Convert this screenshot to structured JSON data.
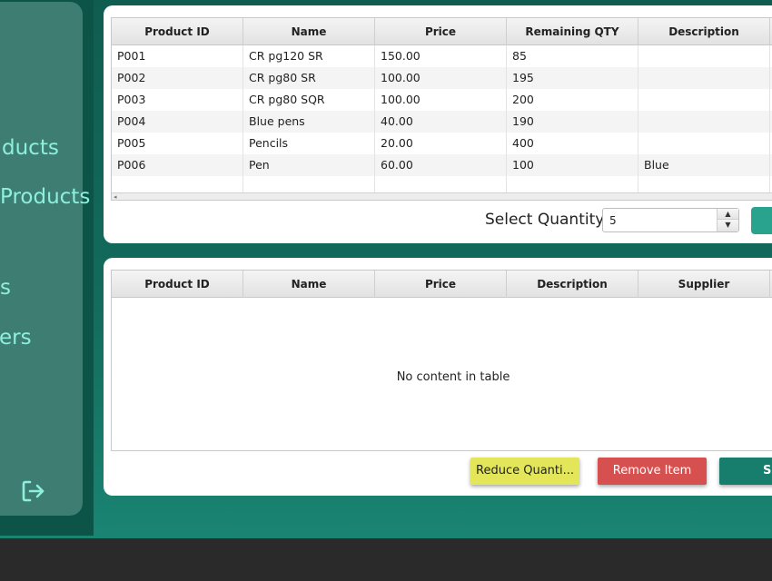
{
  "sidebar": {
    "items": [
      {
        "label": "ducts"
      },
      {
        "label": "Products"
      },
      {
        "label": "s"
      },
      {
        "label": "ers"
      }
    ],
    "logout_icon": "logout-icon"
  },
  "products_table": {
    "columns": [
      "Product ID",
      "Name",
      "Price",
      "Remaining QTY",
      "Description"
    ],
    "rows": [
      [
        "P001",
        "CR pg120 SR",
        "150.00",
        "85",
        ""
      ],
      [
        "P002",
        "CR pg80 SR",
        "100.00",
        "195",
        ""
      ],
      [
        "P003",
        "CR pg80 SQR",
        "100.00",
        "200",
        ""
      ],
      [
        "P004",
        "Blue pens",
        "40.00",
        "190",
        ""
      ],
      [
        "P005",
        "Pencils",
        "20.00",
        "400",
        ""
      ],
      [
        "P006",
        "Pen",
        "60.00",
        "100",
        "Blue"
      ]
    ]
  },
  "quantity": {
    "label": "Select Quantity",
    "value": "5"
  },
  "cart_table": {
    "columns": [
      "Product ID",
      "Name",
      "Price",
      "Description",
      "Supplier"
    ],
    "empty_message": "No content in table"
  },
  "actions": {
    "reduce_label": "Reduce Quanti...",
    "remove_label": "Remove Item",
    "save_label": "S"
  },
  "colors": {
    "accent": "#177e6d",
    "reduce": "#e4e65a",
    "remove": "#d6504f",
    "nav_text": "#8ef0dc"
  }
}
